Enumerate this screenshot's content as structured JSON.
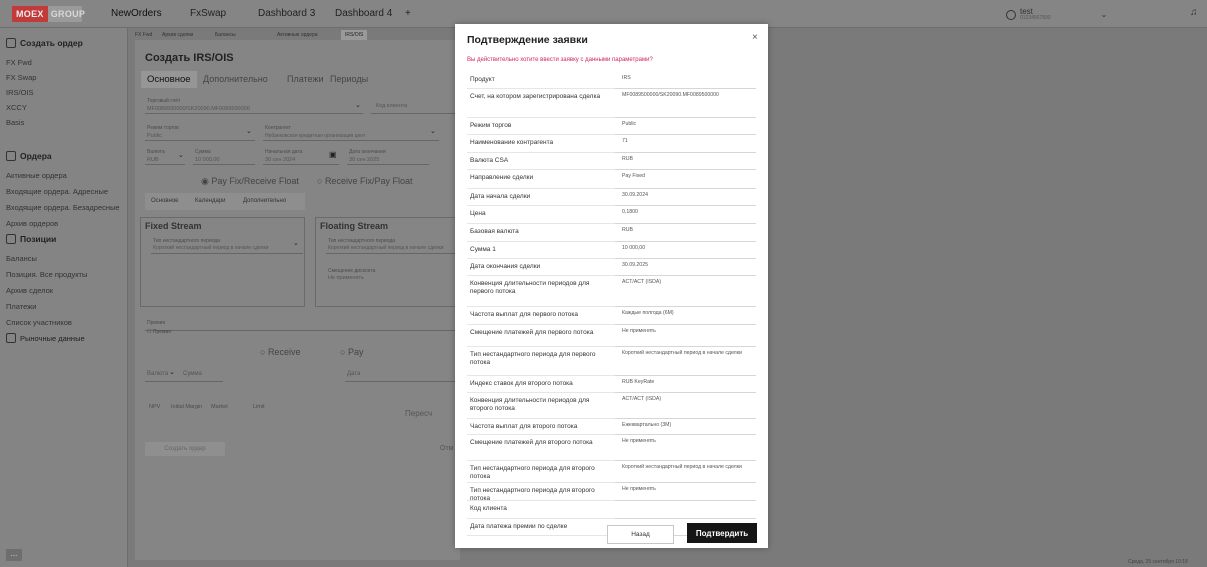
{
  "brand": {
    "moex": "MOEX",
    "group": "GROUP"
  },
  "tabs": [
    "NewOrders",
    "FxSwap",
    "Dashboard 3",
    "Dashboard 4",
    "+"
  ],
  "user": {
    "name": "test",
    "sub": "01234567890"
  },
  "sidebar": {
    "create_title": "Создать ордер",
    "create_items": [
      "FX Fwd",
      "FX Swap",
      "IRS/OIS",
      "XCCY",
      "Basis"
    ],
    "orders_title": "Ордера",
    "orders_items": [
      "Активные ордера",
      "Входящие ордера. Адресные",
      "Входящие ордера. Безадресные",
      "Архив ордеров"
    ],
    "positions_title": "Позиции",
    "positions_items": [
      "Балансы",
      "Позиция. Все продукты",
      "Архив сделок",
      "Платежи",
      "Список участников"
    ],
    "market_title": "Рыночные данные",
    "more": "..."
  },
  "subtabs": [
    "FX Fwd",
    "Архив сделки",
    "Балансы",
    "Активные ордера",
    "IRS/OIS"
  ],
  "form": {
    "title": "Создать IRS/OIS",
    "tabs": [
      "Основное",
      "Дополнительно",
      "Платежи",
      "Периоды"
    ],
    "account_label": "Торговый счёт",
    "account_value": "MF0089500000/SK20090.MF0089500000",
    "client_code": "Код клиента",
    "mode_label": "Режим торгов",
    "mode_value": "Public",
    "counterparty_label": "Контрагент",
    "counterparty_value": "Небанковская кредитная организация цент",
    "currency_label": "Валюта",
    "currency_value": "RUB",
    "amount_label": "Сумма",
    "amount_value": "10 000,00",
    "start_label": "Начальная дата",
    "start_value": "30 сен 2024",
    "end_label": "Дата окончания",
    "end_value": "30 сен 2025",
    "radio1": "Pay Fix/Receive Float",
    "radio2": "Receive Fix/Pay Float",
    "subtabs2": [
      "Основное",
      "Календари",
      "Дополнительно"
    ],
    "fixed_title": "Fixed Stream",
    "floating_title": "Floating Stream",
    "period_label": "Тип нестандартного периода",
    "period_value": "Короткий нестандартный период в начале сделки",
    "offset_label": "Смещение дисконта",
    "offset_value": "Не применять",
    "spread": "Премия",
    "premium": "Премия",
    "receive": "Receive",
    "pay": "Pay",
    "currency2": "Валюта",
    "amount2": "Сумма",
    "date2": "Дата",
    "metrics": [
      "NPV",
      "Initial Margin",
      "Market",
      "Limit"
    ],
    "recalc": "Пересч",
    "create_btn": "Создать ордер",
    "cancel_btn": "Отм"
  },
  "modal": {
    "title": "Подтверждение заявки",
    "close": "×",
    "question": "Вы действительно хотите ввести заявку с данными параметрами?",
    "rows": [
      {
        "k": "Продукт",
        "v": "IRS"
      },
      {
        "k": "Счет, на котором зарегистрирована сделка",
        "v": "MF0089500000/SK20090.MF0089500000"
      },
      {
        "k": "Режим торгов",
        "v": "Public"
      },
      {
        "k": "Наименование контрагента",
        "v": "71"
      },
      {
        "k": "Валюта CSA",
        "v": "RUB"
      },
      {
        "k": "Направление сделки",
        "v": "Pay Fixed"
      },
      {
        "k": "Дата начала сделки",
        "v": "30.09.2024"
      },
      {
        "k": "Цена",
        "v": "0,1800"
      },
      {
        "k": "Базовая валюта",
        "v": "RUB"
      },
      {
        "k": "Сумма 1",
        "v": "10 000,00"
      },
      {
        "k": "Дата окончания сделки",
        "v": "30.09.2025"
      },
      {
        "k": "Конвенция длительности периодов для первого потока",
        "v": "ACT/ACT (ISDA)"
      },
      {
        "k": "Частота выплат для первого потока",
        "v": "Каждые полгода (6M)"
      },
      {
        "k": "Смещение платежей для первого потока",
        "v": "Не применять"
      },
      {
        "k": "Тип нестандартного периода для первого потока",
        "v": "Короткий нестандартный период в начале сделки"
      },
      {
        "k": "Индекс ставок для второго потока",
        "v": "RUB KeyRate"
      },
      {
        "k": "Конвенция длительности периодов для второго потока",
        "v": "ACT/ACT (ISDA)"
      },
      {
        "k": "Частота выплат для второго потока",
        "v": "Ежеквартально (3M)"
      },
      {
        "k": "Смещение платежей для второго потока",
        "v": "Не применять"
      },
      {
        "k": "Тип нестандартного периода для второго потока",
        "v": "Короткий нестандартный период в начале сделки"
      },
      {
        "k": "Тип нестандартного периода для второго потока",
        "v": "Не применять"
      },
      {
        "k": "Код клиента",
        "v": ""
      },
      {
        "k": "Дата платежа премии по сделке",
        "v": ""
      }
    ],
    "back": "Назад",
    "confirm": "Подтвердить"
  },
  "footer": "Среда, 25 сентября 10:18"
}
